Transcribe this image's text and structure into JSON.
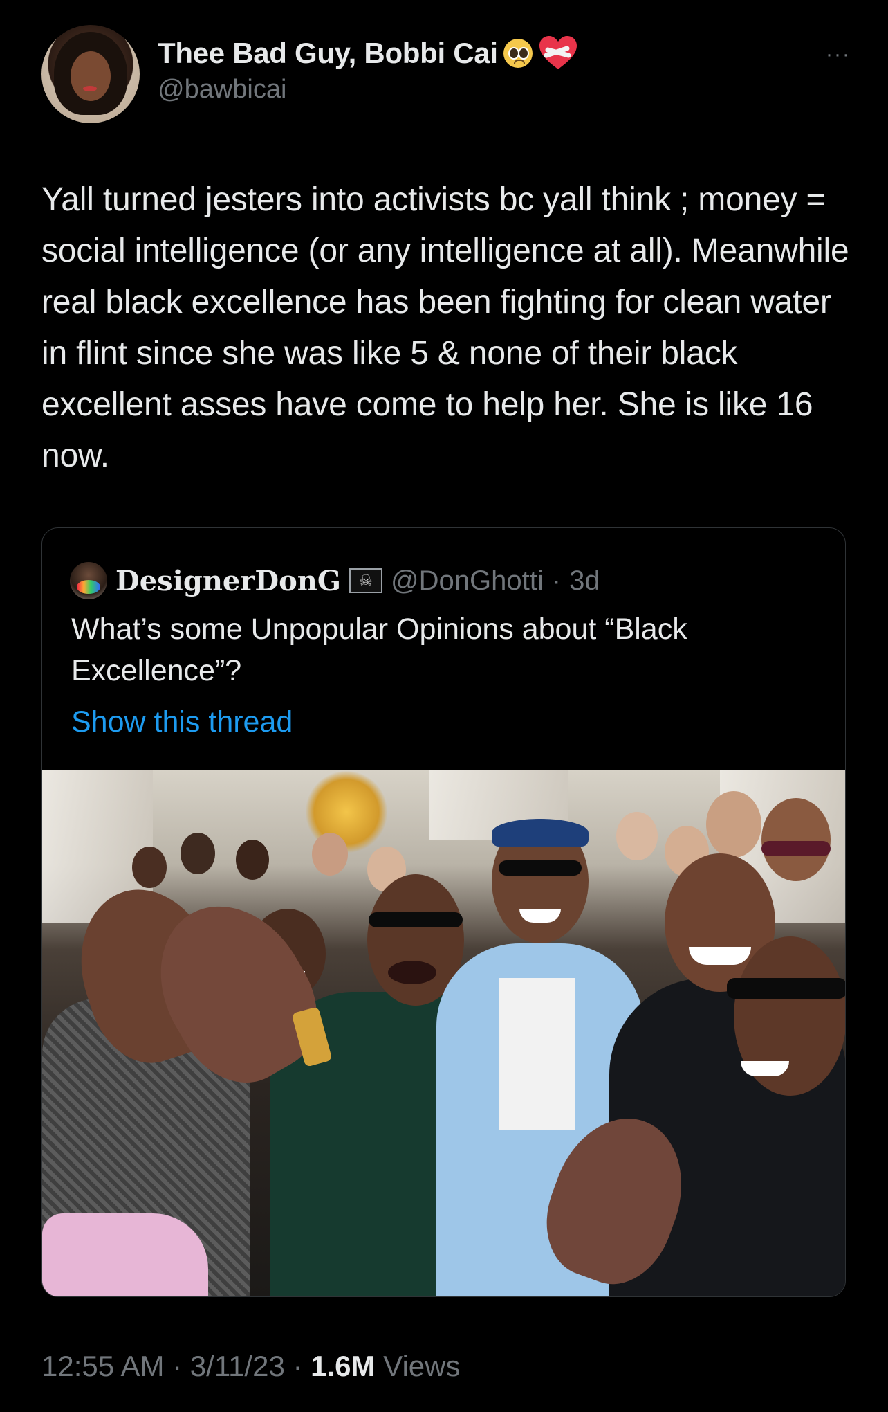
{
  "author": {
    "name": "Thee Bad Guy, Bobbi Cai",
    "handle": "@bawbicai",
    "name_emojis": [
      "pleading-face-icon",
      "mending-heart-icon"
    ]
  },
  "more_label": "···",
  "tweet": {
    "text": "Yall turned jesters into activists bc yall think ; money = social intelligence (or any intelligence at all). Meanwhile real black excellence has been fighting for clean water in flint since she was like 5 & none of their black excellent asses have come to help her. She is like 16 now."
  },
  "quoted": {
    "name": "DesignerDonG",
    "badge": "☠",
    "handle": "@DonGhotti",
    "separator": "·",
    "age": "3d",
    "text": "What’s some Unpopular Opinions about “Black Excellence”?",
    "show_thread": "Show this thread"
  },
  "meta": {
    "time": "12:55 AM",
    "sep1": " · ",
    "date": "3/11/23",
    "sep2": " · ",
    "views_count": "1.6M",
    "views_label": " Views"
  },
  "colors": {
    "background": "#000000",
    "text": "#e7e9ea",
    "muted": "#71767b",
    "link": "#1d9bf0",
    "border": "#2f3336"
  }
}
